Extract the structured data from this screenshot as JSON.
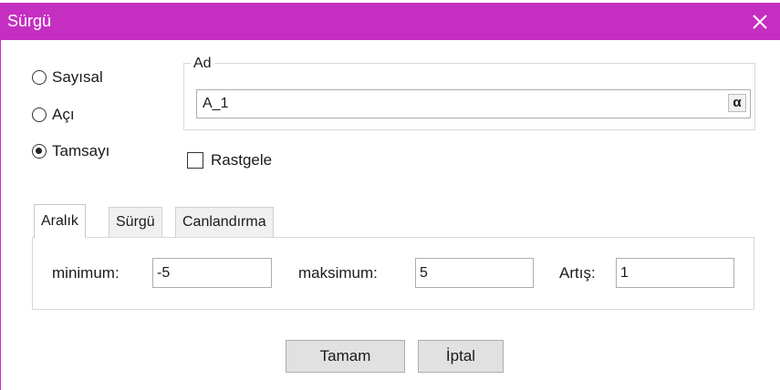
{
  "window": {
    "title": "Sürgü"
  },
  "type_options": [
    {
      "label": "Sayısal",
      "checked": false
    },
    {
      "label": "Açı",
      "checked": false
    },
    {
      "label": "Tamsayı",
      "checked": true
    }
  ],
  "name_group": {
    "legend": "Ad",
    "value": "A_1",
    "symbol_button": "α"
  },
  "random_checkbox": {
    "label": "Rastgele",
    "checked": false
  },
  "tabs": [
    {
      "label": "Aralık",
      "active": true
    },
    {
      "label": "Sürgü",
      "active": false
    },
    {
      "label": "Canlandırma",
      "active": false
    }
  ],
  "interval": {
    "min_label": "minimum:",
    "min_value": "-5",
    "max_label": "maksimum:",
    "max_value": "5",
    "step_label": "Artış:",
    "step_value": "1"
  },
  "buttons": {
    "ok": "Tamam",
    "cancel": "İptal"
  },
  "colors": {
    "titlebar": "#c52fc1",
    "title_text": "#ffffff"
  }
}
